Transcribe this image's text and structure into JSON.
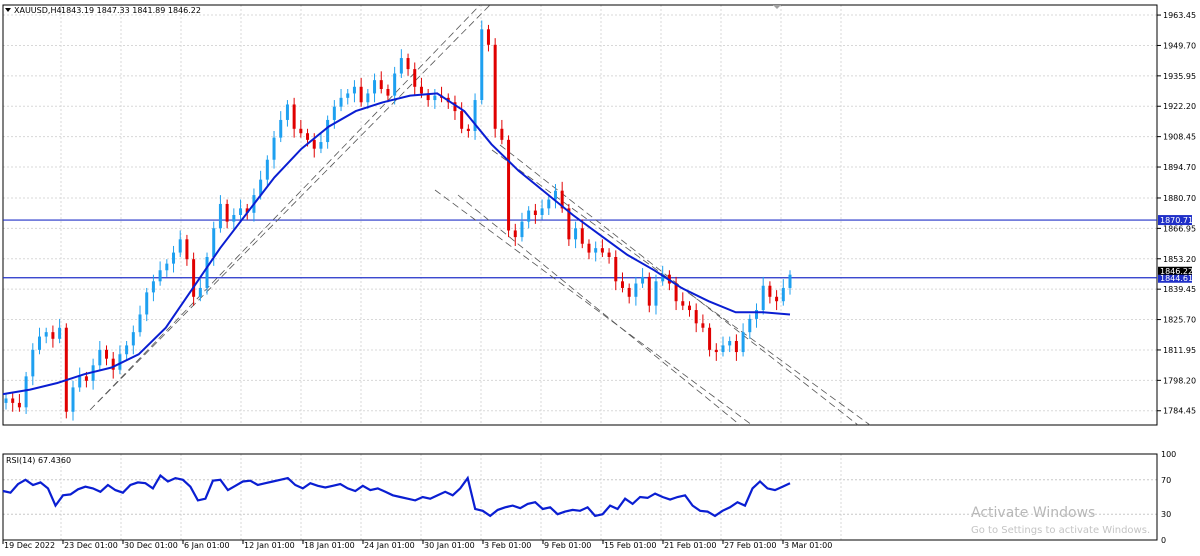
{
  "header": {
    "symbol": "XAUUSD,H4",
    "ohlc": "1843.19 1847.33 1841.89 1846.22"
  },
  "rsi_panel": {
    "label": "RSI(14) 67.4360",
    "levels": [
      "100",
      "70",
      "30",
      "0"
    ]
  },
  "watermark": {
    "title": "Activate Windows",
    "subtitle": "Go to Settings to activate Windows."
  },
  "colors": {
    "bull": "#1ea0f0",
    "bear": "#e00000",
    "ma": "#0a1ed2",
    "hline": "#2030c8",
    "channel": "#555555"
  },
  "chart_data": [
    {
      "type": "line",
      "title": "XAUUSD,H4",
      "y_ticks": [
        "1963.45",
        "1949.70",
        "1935.95",
        "1922.20",
        "1908.45",
        "1894.70",
        "1880.70",
        "1866.95",
        "1853.20",
        "1839.45",
        "1825.70",
        "1811.95",
        "1798.20",
        "1784.45"
      ],
      "ylim": [
        1778,
        1968
      ],
      "x_ticks": [
        "19 Dec 2022",
        "23 Dec 01:00",
        "30 Dec 01:00",
        "6 Jan 01:00",
        "12 Jan 01:00",
        "18 Jan 01:00",
        "24 Jan 01:00",
        "30 Jan 01:00",
        "3 Feb 01:00",
        "9 Feb 01:00",
        "15 Feb 01:00",
        "21 Feb 01:00",
        "27 Feb 01:00",
        "3 Mar 01:00"
      ],
      "horizontal_lines": [
        {
          "value": 1870.71,
          "label": "1870.71"
        },
        {
          "value": 1844.61,
          "label": "1844.61"
        }
      ],
      "current_price": "1846.22",
      "close_series": {
        "name": "",
        "values": [
          1790,
          1788,
          1786,
          1800,
          1812,
          1818,
          1820,
          1817,
          1822,
          1784,
          1795,
          1800,
          1798,
          1805,
          1812,
          1808,
          1803,
          1810,
          1814,
          1820,
          1828,
          1838,
          1843,
          1848,
          1851,
          1856,
          1862,
          1853,
          1836,
          1840,
          1854,
          1867,
          1878,
          1870,
          1873,
          1876,
          1874,
          1882,
          1889,
          1898,
          1908,
          1916,
          1923,
          1912,
          1910,
          1907,
          1903,
          1906,
          1916,
          1922,
          1926,
          1928,
          1931,
          1924,
          1928,
          1934,
          1930,
          1927,
          1937,
          1944,
          1939,
          1931,
          1928,
          1925,
          1927,
          1926,
          1924,
          1920,
          1912,
          1911,
          1925,
          1957,
          1950,
          1912,
          1907,
          1866,
          1863,
          1870,
          1875,
          1873,
          1876,
          1880,
          1884,
          1876,
          1862,
          1867,
          1860,
          1856,
          1858,
          1856,
          1854,
          1843,
          1840,
          1836,
          1842,
          1845,
          1832,
          1843,
          1846,
          1842,
          1834,
          1832,
          1830,
          1824,
          1822,
          1812,
          1811,
          1814,
          1816,
          1811,
          1820,
          1826,
          1830,
          1841,
          1836,
          1834,
          1840,
          1846
        ]
      },
      "moving_average": {
        "name": "",
        "values": [
          1792,
          1794,
          1797,
          1801,
          1804,
          1810,
          1822,
          1840,
          1858,
          1874,
          1890,
          1903,
          1913,
          1920,
          1924,
          1927,
          1928,
          1920,
          1905,
          1893,
          1883,
          1873,
          1864,
          1855,
          1848,
          1840,
          1834,
          1829,
          1829,
          1828
        ]
      }
    },
    {
      "type": "line",
      "title": "RSI(14) 67.4360",
      "ylim": [
        0,
        100
      ],
      "levels": [
        100,
        70,
        30,
        0
      ],
      "series": [
        {
          "name": "",
          "values": [
            57,
            55,
            65,
            70,
            64,
            67,
            60,
            40,
            52,
            53,
            59,
            62,
            60,
            56,
            64,
            58,
            55,
            64,
            67,
            66,
            60,
            75,
            68,
            72,
            70,
            62,
            46,
            48,
            69,
            70,
            58,
            63,
            68,
            69,
            64,
            66,
            68,
            70,
            72,
            64,
            60,
            66,
            63,
            61,
            63,
            65,
            60,
            57,
            63,
            58,
            60,
            56,
            52,
            50,
            48,
            46,
            50,
            48,
            52,
            56,
            52,
            60,
            72,
            36,
            34,
            28,
            35,
            38,
            40,
            37,
            42,
            44,
            36,
            38,
            30,
            33,
            35,
            34,
            38,
            28,
            30,
            40,
            36,
            48,
            42,
            50,
            49,
            54,
            50,
            47,
            50,
            52,
            40,
            34,
            33,
            28,
            34,
            38,
            44,
            40,
            60,
            68,
            60,
            58,
            62,
            66
          ]
        }
      ]
    }
  ]
}
